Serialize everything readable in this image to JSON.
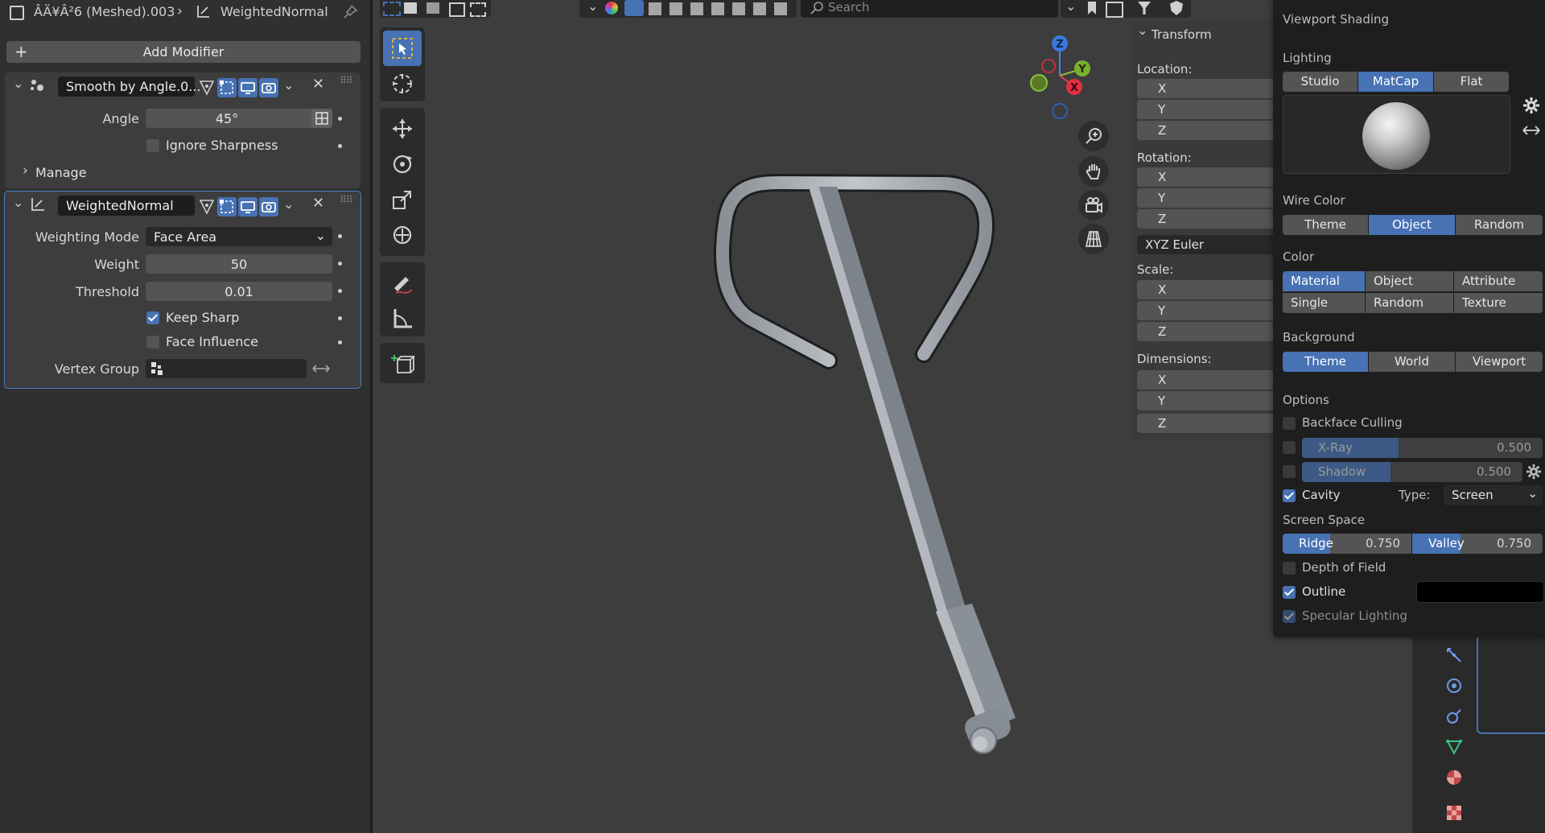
{
  "breadcrumb": {
    "object": "ÂÄ¥Â²6 (Meshed).003",
    "modifier": "WeightedNormal"
  },
  "add_modifier": {
    "label": "Add Modifier"
  },
  "modifiers": {
    "smooth": {
      "name": "Smooth by Angle.0...",
      "angle_label": "Angle",
      "angle_value": "45°",
      "ignore_sharpness_label": "Ignore Sharpness",
      "ignore_sharpness": false,
      "manage_label": "Manage"
    },
    "weighted": {
      "name": "WeightedNormal",
      "mode_label": "Weighting Mode",
      "mode_value": "Face Area",
      "weight_label": "Weight",
      "weight_value": "50",
      "threshold_label": "Threshold",
      "threshold_value": "0.01",
      "keep_sharp_label": "Keep Sharp",
      "keep_sharp": true,
      "face_influence_label": "Face Influence",
      "face_influence": false,
      "vertex_group_label": "Vertex Group"
    }
  },
  "header": {
    "search_placeholder": "Search"
  },
  "gizmo": {
    "x": "X",
    "y": "Y",
    "z": "Z"
  },
  "transform": {
    "title": "Transform",
    "location_label": "Location:",
    "rotation_label": "Rotation:",
    "rotation_mode": "XYZ Euler",
    "scale_label": "Scale:",
    "dimensions_label": "Dimensions:",
    "axes": [
      "X",
      "Y",
      "Z"
    ]
  },
  "shading": {
    "title": "Viewport Shading",
    "lighting_label": "Lighting",
    "lighting_options": [
      "Studio",
      "MatCap",
      "Flat"
    ],
    "lighting_selected": "MatCap",
    "wire_color_label": "Wire Color",
    "wire_options": [
      "Theme",
      "Object",
      "Random"
    ],
    "wire_selected": "Object",
    "color_label": "Color",
    "color_options_row1": [
      "Material",
      "Object",
      "Attribute"
    ],
    "color_options_row2": [
      "Single",
      "Random",
      "Texture"
    ],
    "color_selected": "Material",
    "background_label": "Background",
    "background_options": [
      "Theme",
      "World",
      "Viewport"
    ],
    "background_selected": "Theme",
    "options_label": "Options",
    "backface_culling_label": "Backface Culling",
    "xray_label": "X-Ray",
    "xray_value": "0.500",
    "shadow_label": "Shadow",
    "shadow_value": "0.500",
    "cavity_label": "Cavity",
    "cavity_type_label": "Type:",
    "cavity_type_value": "Screen",
    "screen_space_label": "Screen Space",
    "ridge_label": "Ridge",
    "ridge_value": "0.750",
    "valley_label": "Valley",
    "valley_value": "0.750",
    "dof_label": "Depth of Field",
    "outline_label": "Outline",
    "specular_label": "Specular Lighting",
    "accent_color": "#4772b3"
  }
}
